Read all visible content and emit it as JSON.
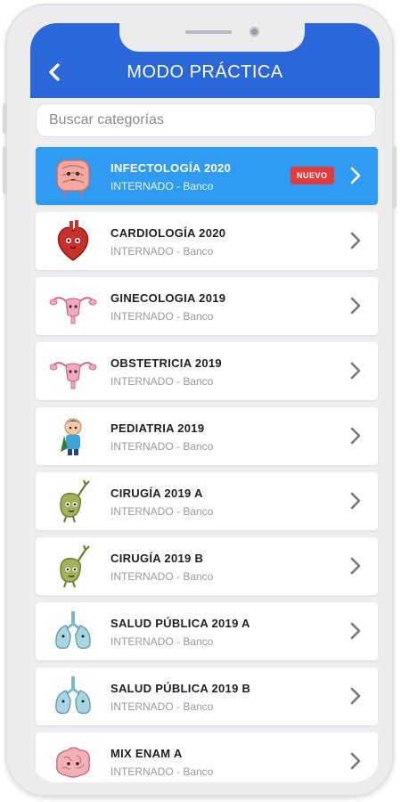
{
  "header": {
    "title": "MODO PRÁCTICA"
  },
  "search": {
    "placeholder": "Buscar categorías"
  },
  "categories": [
    {
      "name": "INFECTOLOGÍA 2020",
      "subtitle": "INTERNADO - Banco",
      "badge": "NUEVO",
      "icon": "intestine-icon",
      "active": true
    },
    {
      "name": "CARDIOLOGÍA 2020",
      "subtitle": "INTERNADO - Banco",
      "icon": "heart-icon"
    },
    {
      "name": "GINECOLOGIA 2019",
      "subtitle": "INTERNADO - Banco",
      "icon": "uterus-icon"
    },
    {
      "name": "OBSTETRICIA 2019",
      "subtitle": "INTERNADO - Banco",
      "icon": "uterus-icon"
    },
    {
      "name": "PEDIATRIA 2019",
      "subtitle": "INTERNADO - Banco",
      "icon": "child-icon"
    },
    {
      "name": "CIRUGÍA 2019 A",
      "subtitle": "INTERNADO - Banco",
      "icon": "gallbladder-icon"
    },
    {
      "name": "CIRUGÍA 2019 B",
      "subtitle": "INTERNADO - Banco",
      "icon": "gallbladder-icon"
    },
    {
      "name": "SALUD PÚBLICA 2019 A",
      "subtitle": "INTERNADO - Banco",
      "icon": "lungs-icon"
    },
    {
      "name": "SALUD PÚBLICA 2019 B",
      "subtitle": "INTERNADO - Banco",
      "icon": "lungs-icon"
    },
    {
      "name": "MIX ENAM A",
      "subtitle": "INTERNADO - Banco",
      "icon": "brain-icon"
    }
  ],
  "colors": {
    "header": "#2a67d8",
    "active_row": "#2f9bf2",
    "badge": "#e33b3b"
  }
}
